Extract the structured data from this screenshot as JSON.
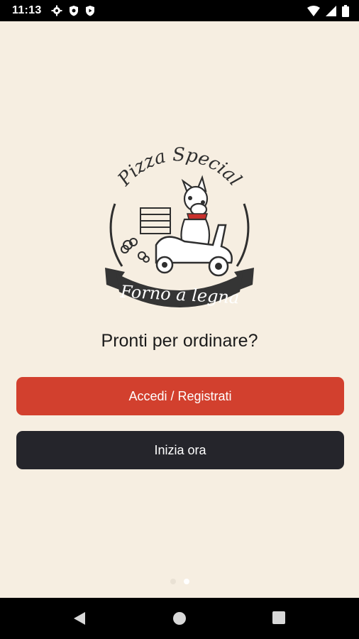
{
  "status_bar": {
    "time": "11:13",
    "left_icons": [
      "gear-icon",
      "shield-icon",
      "play-shield-icon"
    ],
    "right_icons": [
      "wifi-icon",
      "signal-icon",
      "battery-icon"
    ]
  },
  "logo": {
    "brand_top": "Pizza Special",
    "ribbon_text": "Forno a legna"
  },
  "headline": "Pronti per ordinare?",
  "buttons": {
    "login_label": "Accedi / Registrati",
    "start_label": "Inizia ora"
  },
  "colors": {
    "background": "#f6eee1",
    "login_button": "#d2402e",
    "start_button": "#25252b",
    "logo_ink": "#2f2f2f"
  },
  "pager": {
    "pages": 2,
    "active": 2
  },
  "nav_bar": {
    "icons": [
      "back-icon",
      "home-icon",
      "recents-icon"
    ]
  }
}
